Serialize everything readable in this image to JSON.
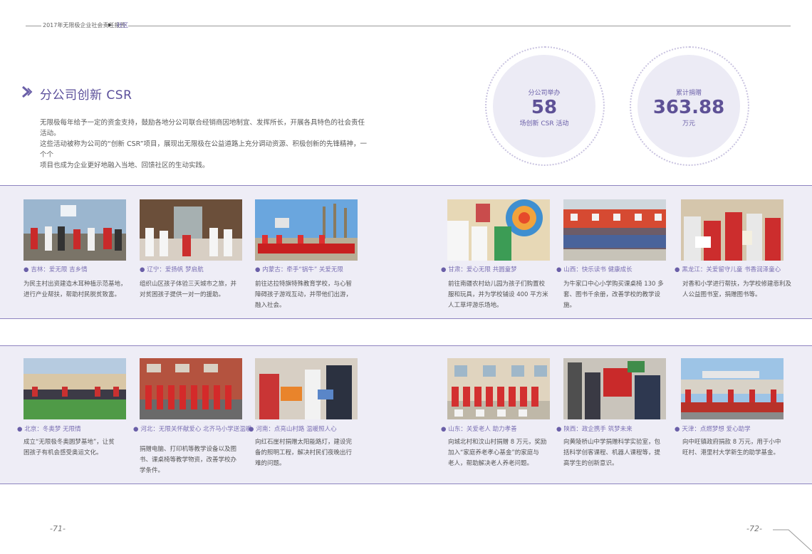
{
  "header": {
    "text": "2017年无限极企业社会责任报告",
    "section": "社区"
  },
  "title": "分公司创新 CSR",
  "intro": [
    "无限极每年给予一定的资金支持，鼓励各地分公司联合经销商因地制宜、发挥所长，开展各具特色的社会责任活动。",
    "这些活动被称为公司的“创新 CSR”项目，展现出无限极在公益道路上充分调动资源、积极创新的先锋精神，一个个",
    "项目也成为企业更好地融入当地、回馈社区的生动实践。"
  ],
  "stats": [
    {
      "label": "分公司举办",
      "value": "58",
      "unit": "场创新 CSR 活动"
    },
    {
      "label": "累计捐赠",
      "value": "363.88",
      "unit": "万元"
    }
  ],
  "colors": {
    "accent": "#6a5fa8",
    "band": "#eeedf6"
  },
  "cards": [
    {
      "caption": "吉林：爱无限 吉乡情",
      "desc": [
        "为民主村出资建造木耳种植示范基地，",
        "进行产业帮扶，帮助村民脱贫致富。"
      ]
    },
    {
      "caption": "辽宁：爱扬帆 梦启航",
      "desc": [
        "组织山区孩子体验三天城市之旅，并",
        "对贫困孩子提供一对一的援助。"
      ]
    },
    {
      "caption": "内蒙古：牵手“锅牛” 关爱无限",
      "desc": [
        "前往达拉特旗特殊教育学校，与心智",
        "障碍孩子游戏互动，并带他们出游，",
        "融入社会。"
      ]
    },
    {
      "caption": "甘肃：爱心无限 共圆童梦",
      "desc": [
        "前往南疆农村幼儿园为孩子们购置校",
        "服和玩具，并为学校铺设 400 平方米",
        "人工草坪游乐场地。"
      ]
    },
    {
      "caption": "山西：快乐读书 健康成长",
      "desc": [
        "为牛家口中心小学购买课桌椅 130 多",
        "套、图书千余册，改善学校的教学设施。"
      ]
    },
    {
      "caption": "黑龙江：关爱留守儿童 书香润泽童心",
      "desc": [
        "对香和小学进行帮扶，为学校修建悲利及",
        "人公益图书室，捐赠图书等。"
      ]
    },
    {
      "caption": "北京：冬奥梦 无限情",
      "desc": [
        "成立“无限极冬奥圆梦基地”，让贫",
        "困孩子有机会感受奥运文化。"
      ]
    },
    {
      "caption": "河北：无限关怀献爱心 北齐马小学送温暖",
      "desc": [
        "捐赠电脑、打印机等教学设备以及图",
        "书、课桌椅等教学物资，改善学校办",
        "学条件。"
      ]
    },
    {
      "caption": "河南：点亮山村路 温暖照人心",
      "desc": [
        "向红石崖村捐赠太阳能路灯，建设完",
        "备的照明工程，解决村民们夜晚出行",
        "难的问题。"
      ]
    },
    {
      "caption": "山东：关爱老人 助力孝善",
      "desc": [
        "向城北村和汶山村捐赠 8 万元，奖励",
        "加入“家庭养老孝心基金”的家庭与",
        "老人，帮助解决老人养老问题。"
      ]
    },
    {
      "caption": "陕西：政企携手 筑梦未来",
      "desc": [
        "向黄陵桥山中学捐赠科学实验室，包",
        "括科学创客课程、机器人课程等，提",
        "高学生的创新意识。"
      ]
    },
    {
      "caption": "天津：点燃梦想 爱心助学",
      "desc": [
        "向中旺镇政府捐款 8 万元，用于小中",
        "旺村、港里村大学新生的助学基金。"
      ]
    }
  ],
  "pages": {
    "left": "-71-",
    "right": "-72-"
  }
}
